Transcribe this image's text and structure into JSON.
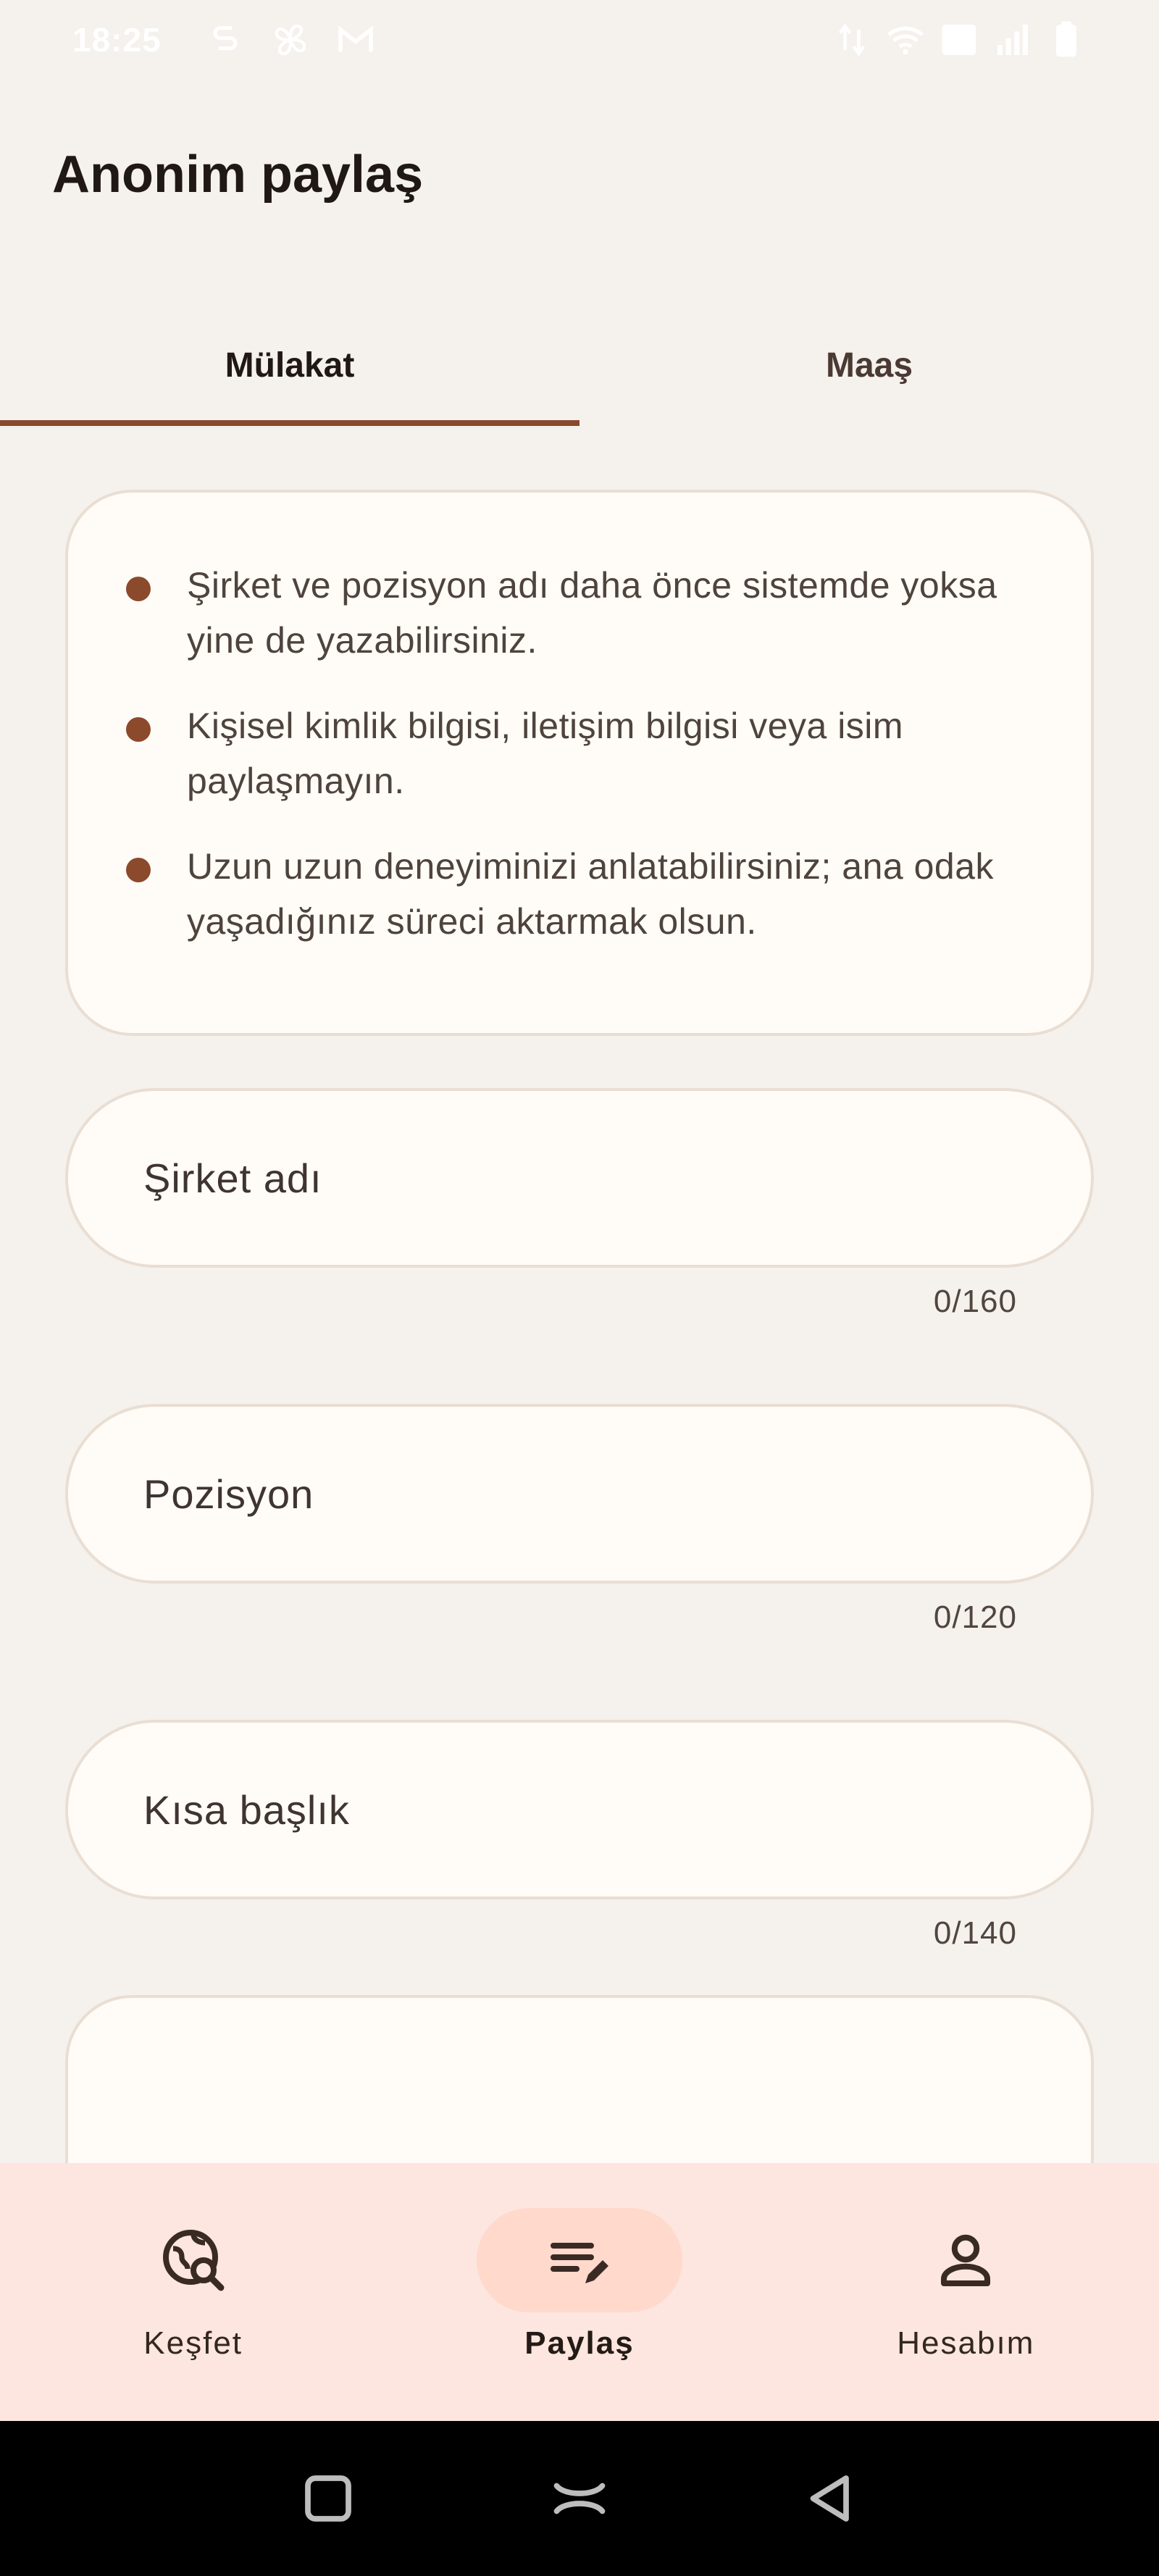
{
  "status_bar": {
    "time": "18:25"
  },
  "header": {
    "title": "Anonim paylaş"
  },
  "tabs": [
    {
      "label": "Mülakat",
      "active": true
    },
    {
      "label": "Maaş",
      "active": false
    }
  ],
  "info": {
    "items": [
      "Şirket ve pozisyon adı daha önce sistemde yoksa yine de yazabilirsiniz.",
      "Kişisel kimlik bilgisi, iletişim bilgisi veya isim paylaşmayın.",
      "Uzun uzun deneyiminizi anlatabilirsiniz; ana odak yaşadığınız süreci aktarmak olsun."
    ]
  },
  "form": {
    "company": {
      "placeholder": "Şirket adı",
      "counter": "0/160"
    },
    "position": {
      "placeholder": "Pozisyon",
      "counter": "0/120"
    },
    "short_title": {
      "placeholder": "Kısa başlık",
      "counter": "0/140"
    }
  },
  "bottom_nav": {
    "items": [
      {
        "label": "Keşfet",
        "icon": "explore-search-icon",
        "active": false
      },
      {
        "label": "Paylaş",
        "icon": "edit-note-icon",
        "active": true
      },
      {
        "label": "Hesabım",
        "icon": "person-icon",
        "active": false
      }
    ]
  },
  "colors": {
    "background": "#f5f1ec",
    "accent": "#8a4a2d",
    "card": "#fffbf6",
    "nav_background": "#fde6df",
    "nav_active_pill": "#ffd9cc"
  }
}
